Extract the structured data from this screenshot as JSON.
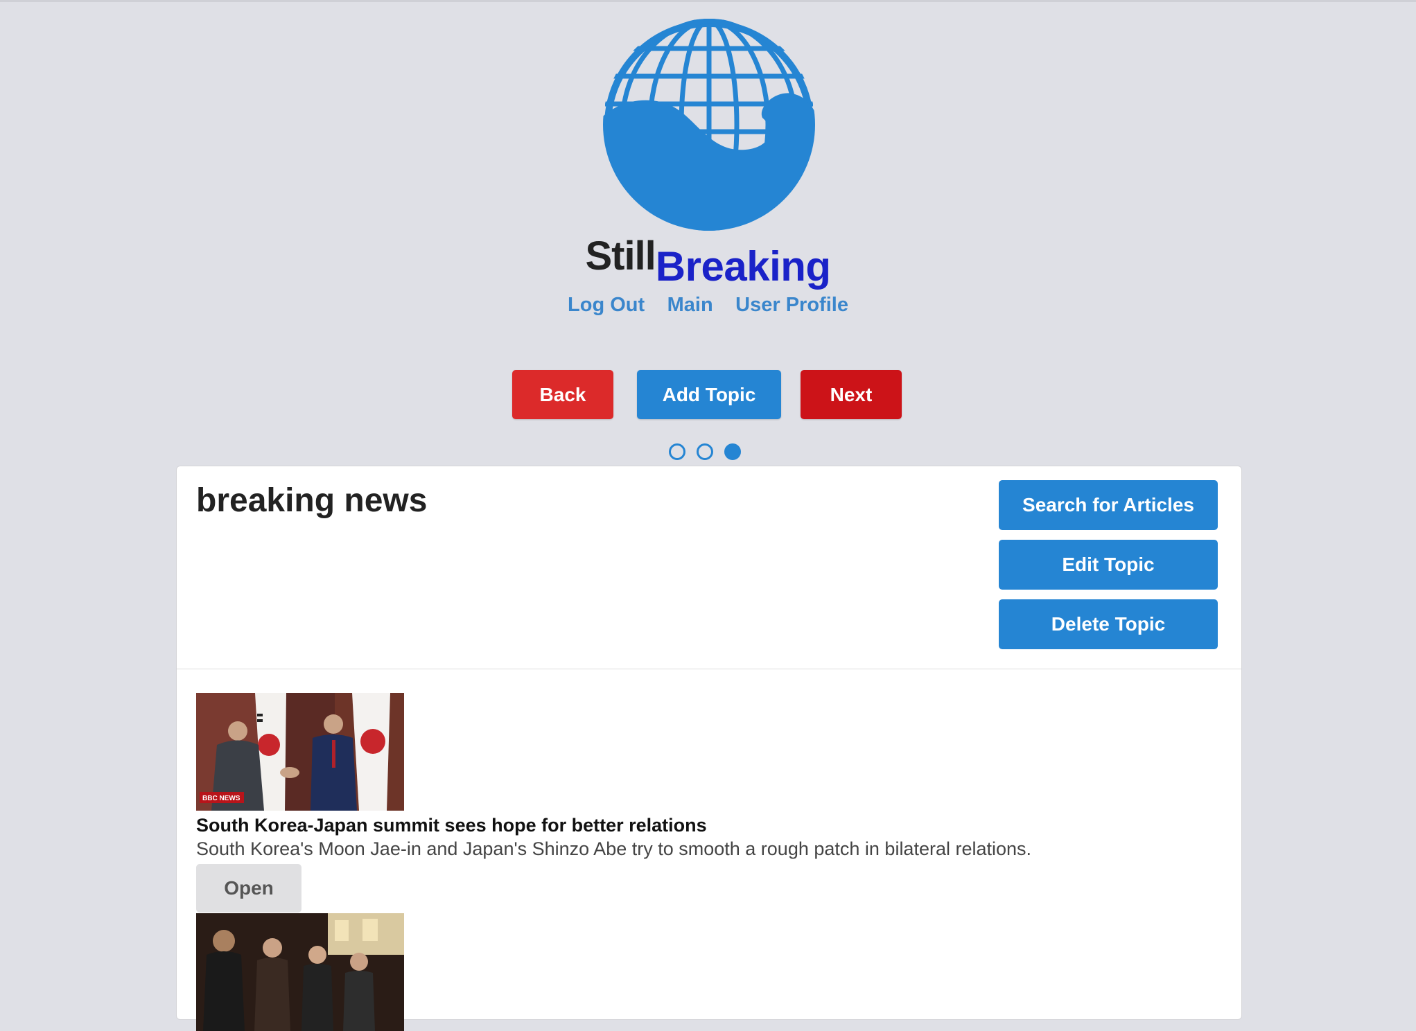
{
  "brand": {
    "still": "Still",
    "breaking": "Breaking"
  },
  "nav": {
    "logout": "Log Out",
    "main": "Main",
    "profile": "User Profile"
  },
  "controls": {
    "back": "Back",
    "add_topic": "Add Topic",
    "next": "Next"
  },
  "pager": {
    "total": 3,
    "active": 3
  },
  "topic": {
    "title": "breaking news",
    "search_label": "Search for Articles",
    "edit_label": "Edit Topic",
    "delete_label": "Delete Topic"
  },
  "articles": [
    {
      "title": "South Korea-Japan summit sees hope for better relations",
      "description": "South Korea's Moon Jae-in and Japan's Shinzo Abe try to smooth a rough patch in bilateral relations.",
      "open_label": "Open",
      "image_badge": "BBC NEWS"
    },
    {
      "title": "",
      "description": "",
      "open_label": ""
    }
  ],
  "colors": {
    "background": "#dfe0e6",
    "accent_blue": "#2585d3",
    "back_red": "#dc2a2a",
    "next_red": "#cc1318",
    "breaking_text": "#1a22c8",
    "link": "#3a86cc"
  }
}
